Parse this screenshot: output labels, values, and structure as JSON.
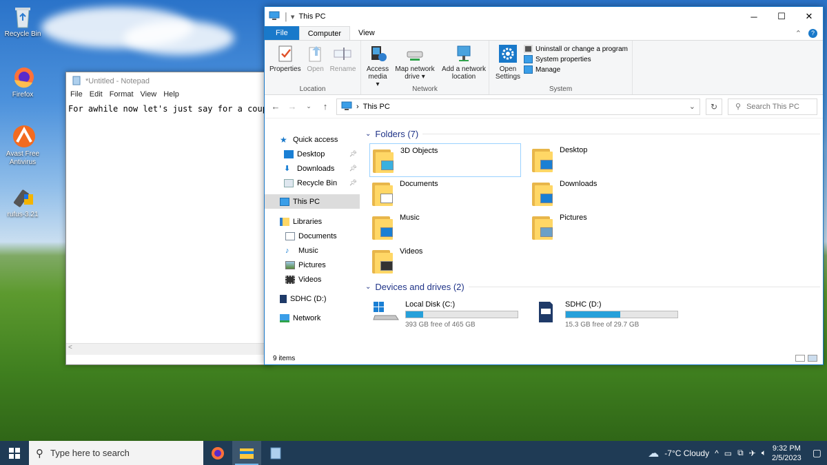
{
  "desktop": {
    "icons": [
      {
        "label": "Recycle Bin",
        "icon": "recycle-bin-icon"
      },
      {
        "label": "Firefox",
        "icon": "firefox-icon"
      },
      {
        "label": "Avast Free Antivirus",
        "icon": "avast-icon"
      },
      {
        "label": "rufus-3.21",
        "icon": "rufus-icon"
      }
    ]
  },
  "notepad": {
    "title": "*Untitled - Notepad",
    "menu": [
      "File",
      "Edit",
      "Format",
      "View",
      "Help"
    ],
    "text": "For awhile now let's just say for a coupl",
    "scroll_glyph": "<"
  },
  "explorer": {
    "title": "This PC",
    "tabs": {
      "file": "File",
      "computer": "Computer",
      "view": "View"
    },
    "ribbon": {
      "location": {
        "label": "Location",
        "properties": "Properties",
        "open": "Open",
        "rename": "Rename"
      },
      "network": {
        "label": "Network",
        "access_media": "Access media ▾",
        "map_network_drive": "Map network drive ▾",
        "add_network_location": "Add a network location"
      },
      "system": {
        "label": "System",
        "open_settings": "Open Settings",
        "uninstall": "Uninstall or change a program",
        "system_properties": "System properties",
        "manage": "Manage"
      }
    },
    "address": {
      "path": "This PC",
      "search_placeholder": "Search This PC"
    },
    "nav": {
      "quick_access": "Quick access",
      "desktop": "Desktop",
      "downloads": "Downloads",
      "recycle_bin": "Recycle Bin",
      "this_pc": "This PC",
      "libraries": "Libraries",
      "documents": "Documents",
      "music": "Music",
      "pictures": "Pictures",
      "videos": "Videos",
      "sdhc": "SDHC (D:)",
      "network": "Network"
    },
    "folders_header": "Folders (7)",
    "folders": [
      {
        "name": "3D Objects",
        "overlay_color": "#3ab0e0"
      },
      {
        "name": "Desktop",
        "overlay_color": "#1a7fd4"
      },
      {
        "name": "Documents",
        "overlay_color": "#ffffff"
      },
      {
        "name": "Downloads",
        "overlay_color": "#1a7fd4"
      },
      {
        "name": "Music",
        "overlay_color": "#1a7fd4"
      },
      {
        "name": "Pictures",
        "overlay_color": "#6aa0c8"
      },
      {
        "name": "Videos",
        "overlay_color": "#333333"
      }
    ],
    "drives_header": "Devices and drives (2)",
    "drives": [
      {
        "name": "Local Disk (C:)",
        "free": "393 GB free of 465 GB",
        "used_fraction": 0.155
      },
      {
        "name": "SDHC (D:)",
        "free": "15.3 GB free of 29.7 GB",
        "used_fraction": 0.485
      }
    ],
    "status": "9 items"
  },
  "taskbar": {
    "search_placeholder": "Type here to search",
    "weather": "-7°C  Cloudy",
    "time": "9:32 PM",
    "date": "2/5/2023"
  },
  "colors": {
    "accent": "#1979ca",
    "drive_bar": "#26a0da",
    "folder": "#ffd766",
    "taskbar": "#1f3b55"
  }
}
